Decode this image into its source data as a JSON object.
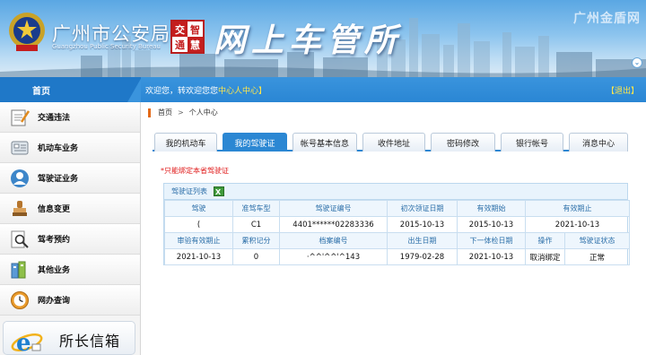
{
  "header": {
    "bureau_cn": "广州市公安局",
    "bureau_en": "Guangzhou Public Security Bureau",
    "seal_chars": [
      "交",
      "智",
      "通",
      "慧"
    ],
    "site_name": "网上车管所",
    "corner_logo": "广州金盾网"
  },
  "topbar": {
    "home_label": "首页",
    "welcome_prefix": "欢迎您，转欢迎您您",
    "welcome_link": "中心",
    "welcome_suffix": "人中心】",
    "logout_label": "【退出】"
  },
  "sidebar": {
    "items": [
      {
        "label": "交通违法",
        "icon": "notepad-icon"
      },
      {
        "label": "机动车业务",
        "icon": "car-icon"
      },
      {
        "label": "驾驶证业务",
        "icon": "person-icon"
      },
      {
        "label": "信息变更",
        "icon": "stamp-icon"
      },
      {
        "label": "驾考预约",
        "icon": "magnifier-icon"
      },
      {
        "label": "其他业务",
        "icon": "database-icon"
      },
      {
        "label": "网办查询",
        "icon": "clock-icon"
      }
    ],
    "promo_label": "所长信箱"
  },
  "breadcrumb": {
    "home": "首页",
    "separator": ">",
    "current": "个人中心"
  },
  "tabs": [
    {
      "label": "我的机动车",
      "active": false
    },
    {
      "label": "我的驾驶证",
      "active": true
    },
    {
      "label": "帐号基本信息",
      "active": false
    },
    {
      "label": "收件地址",
      "active": false
    },
    {
      "label": "密码修改",
      "active": false
    },
    {
      "label": "银行帐号",
      "active": false
    },
    {
      "label": "消息中心",
      "active": false
    }
  ],
  "notice": "*只能绑定本省驾驶证",
  "license_table": {
    "title": "驾驶证列表",
    "headers_row1": [
      "驾驶",
      "准驾车型",
      "驾驶证编号",
      "初次领证日期",
      "有效期始",
      "有效期止"
    ],
    "values_row1": [
      "(",
      "C1",
      "4401******02283336",
      "2015-10-13",
      "2015-10-13",
      "2021-10-13"
    ],
    "headers_row2": [
      "审验有效期止",
      "累积记分",
      "档案编号",
      "出生日期",
      "下一体检日期",
      "操作",
      "驾驶证状态"
    ],
    "values_row2": [
      "2021-10-13",
      "0",
      "·^^'^^'^143",
      "1979-02-28",
      "2021-10-13",
      "取消绑定",
      "正常"
    ]
  },
  "colors": {
    "primary_blue": "#2b87d3",
    "notice_red": "#e01b1b",
    "highlight_yellow": "#ffe64a"
  }
}
